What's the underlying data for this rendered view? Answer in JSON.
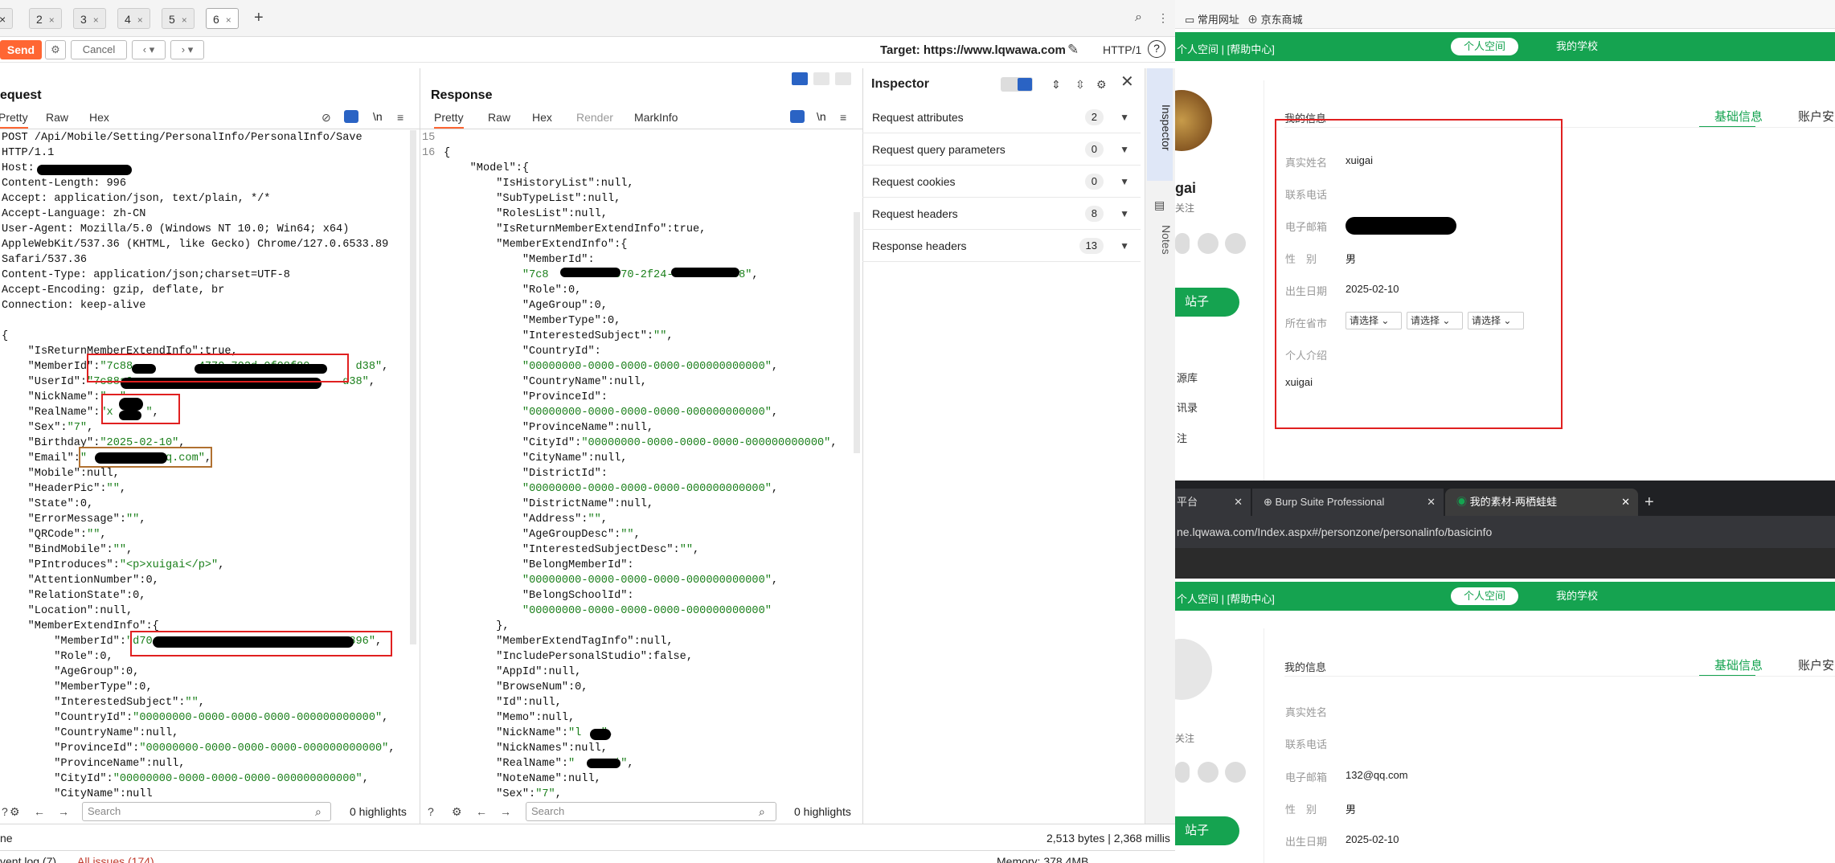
{
  "tabs": [
    {
      "label": "×"
    },
    {
      "label": "2"
    },
    {
      "label": "3"
    },
    {
      "label": "4"
    },
    {
      "label": "5"
    },
    {
      "label": "6"
    }
  ],
  "toolbar": {
    "send": "Send",
    "cancel": "Cancel",
    "target": "Target: https://www.lqwawa.com",
    "http": "HTTP/1"
  },
  "request": {
    "title": "equest",
    "tabs": [
      "Pretty",
      "Raw",
      "Hex"
    ],
    "newline": "\\n",
    "lines": [
      "POST /Api/Mobile/Setting/PersonalInfo/PersonalInfo/Save",
      "HTTP/1.1",
      "Host: ",
      "Content-Length: 996",
      "Accept: application/json, text/plain, */*",
      "Accept-Language: zh-CN",
      "User-Agent: Mozilla/5.0 (Windows NT 10.0; Win64; x64)",
      "AppleWebKit/537.36 (KHTML, like Gecko) Chrome/127.0.6533.89",
      "Safari/537.36",
      "Content-Type: application/json;charset=UTF-8",
      "Accept-Encoding: gzip, deflate, br",
      "Connection: keep-alive",
      "",
      "{",
      "    \"IsReturnMemberExtendInfo\":true,",
      "    \"MemberId\":\"7c88          4770-702d-0f08f80       d38\",",
      "    \"UserId\":\"7c88a0                                d38\",",
      "    \"NickName\":\"  \",",
      "    \"RealName\":\"x     \",",
      "    \"Sex\":\"7\",",
      "    \"Birthday\":\"2025-02-10\",",
      "    \"Email\":\"            q.com\",",
      "    \"Mobile\":null,",
      "    \"HeaderPic\":\"\",",
      "    \"State\":0,",
      "    \"ErrorMessage\":\"\",",
      "    \"QRCode\":\"\",",
      "    \"BindMobile\":\"\",",
      "    \"PIntroduces\":\"<p>xuigai</p>\",",
      "    \"AttentionNumber\":0,",
      "    \"RelationState\":0,",
      "    \"Location\":null,",
      "    \"MemberExtendInfo\":{",
      "        \"MemberId\":\"d70                             6896\",",
      "        \"Role\":0,",
      "        \"AgeGroup\":0,",
      "        \"MemberType\":0,",
      "        \"InterestedSubject\":\"\",",
      "        \"CountryId\":\"00000000-0000-0000-0000-000000000000\",",
      "        \"CountryName\":null,",
      "        \"ProvinceId\":\"00000000-0000-0000-0000-000000000000\",",
      "        \"ProvinceName\":null,",
      "        \"CityId\":\"00000000-0000-0000-0000-000000000000\",",
      "        \"CityName\":null"
    ],
    "search_placeholder": "Search",
    "highlights": "0 highlights"
  },
  "response": {
    "title": "Response",
    "tabs": [
      "Pretty",
      "Raw",
      "Hex",
      "Render",
      "MarkInfo"
    ],
    "newline": "\\n",
    "line_numbers": [
      "15",
      "16"
    ],
    "lines": [
      "",
      "{",
      "    \"Model\":{",
      "        \"IsHistoryList\":null,",
      "        \"SubTypeList\":null,",
      "        \"RolesList\":null,",
      "        \"IsReturnMemberExtendInfo\":true,",
      "        \"MemberExtendInfo\":{",
      "            \"MemberId\":",
      "            \"7c8     4fc7-070-2f24-0f6   b6d38\",",
      "            \"Role\":0,",
      "            \"AgeGroup\":0,",
      "            \"MemberType\":0,",
      "            \"InterestedSubject\":\"\",",
      "            \"CountryId\":",
      "            \"00000000-0000-0000-0000-000000000000\",",
      "            \"CountryName\":null,",
      "            \"ProvinceId\":",
      "            \"00000000-0000-0000-0000-000000000000\",",
      "            \"ProvinceName\":null,",
      "            \"CityId\":\"00000000-0000-0000-0000-000000000000\",",
      "            \"CityName\":null,",
      "            \"DistrictId\":",
      "            \"00000000-0000-0000-0000-000000000000\",",
      "            \"DistrictName\":null,",
      "            \"Address\":\"\",",
      "            \"AgeGroupDesc\":\"\",",
      "            \"InterestedSubjectDesc\":\"\",",
      "            \"BelongMemberId\":",
      "            \"00000000-0000-0000-0000-000000000000\",",
      "            \"BelongSchoolId\":",
      "            \"00000000-0000-0000-0000-000000000000\"",
      "        },",
      "        \"MemberExtendTagInfo\":null,",
      "        \"IncludePersonalStudio\":false,",
      "        \"AppId\":null,",
      "        \"BrowseNum\":0,",
      "        \"Id\":null,",
      "        \"Memo\":null,",
      "        \"NickName\":\"l   \",",
      "        \"NickNames\":null,",
      "        \"RealName\":\"      i\",",
      "        \"NoteName\":null,",
      "        \"Sex\":\"7\","
    ],
    "search_placeholder": "Search",
    "highlights": "0 highlights"
  },
  "inspector": {
    "title": "Inspector",
    "rows": [
      {
        "label": "Request attributes",
        "count": "2"
      },
      {
        "label": "Request query parameters",
        "count": "0"
      },
      {
        "label": "Request cookies",
        "count": "0"
      },
      {
        "label": "Request headers",
        "count": "8"
      },
      {
        "label": "Response headers",
        "count": "13"
      }
    ],
    "side": [
      "Inspector",
      "Notes"
    ]
  },
  "statusbar": {
    "bytes": "2,513 bytes | 2,368 millis",
    "left": "ne",
    "eventlog": "vent log (7)",
    "issues": "All issues (174)",
    "memory": "Memory: 378.4MB"
  },
  "browser_top": {
    "bookmarks": [
      "常用网址",
      "京东商城"
    ]
  },
  "site1": {
    "top_links": "个人空间 | [帮助中心]",
    "pills": [
      "个人空间",
      "我的学校"
    ],
    "section": "我的信息",
    "tabs": [
      "基础信息",
      "账户安"
    ],
    "name_partial": "gai",
    "follow": "关注",
    "side_button": "站子",
    "side_items": [
      "源库",
      "讯录",
      "注"
    ],
    "fields": [
      {
        "label": "真实姓名",
        "value": "xuigai"
      },
      {
        "label": "联系电话",
        "value": ""
      },
      {
        "label": "电子邮箱",
        "value": ""
      },
      {
        "label": "性　别",
        "value": "男"
      },
      {
        "label": "出生日期",
        "value": "2025-02-10"
      },
      {
        "label": "所在省市",
        "value": ""
      },
      {
        "label": "个人介绍",
        "value": ""
      }
    ],
    "selects": [
      "请选择",
      "请选择",
      "请选择"
    ],
    "intro": "xuigai"
  },
  "browser2": {
    "tabs": [
      "平台",
      "Burp Suite Professional",
      "我的素材-两栖蛙蛙"
    ],
    "url": "ne.lqwawa.com/Index.aspx#/personzone/personalinfo/basicinfo"
  },
  "site2": {
    "top_links": "个人空间 | [帮助中心]",
    "pills": [
      "个人空间",
      "我的学校"
    ],
    "section": "我的信息",
    "tabs": [
      "基础信息",
      "账户安"
    ],
    "follow": "关注",
    "side_button": "站子",
    "fields": [
      {
        "label": "真实姓名",
        "value": ""
      },
      {
        "label": "联系电话",
        "value": ""
      },
      {
        "label": "电子邮箱",
        "value": "132@qq.com"
      },
      {
        "label": "性　别",
        "value": "男"
      },
      {
        "label": "出生日期",
        "value": "2025-02-10"
      }
    ]
  }
}
